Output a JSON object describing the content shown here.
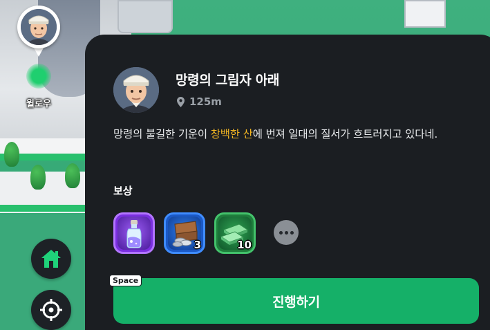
{
  "map": {
    "player_label": "윌로우"
  },
  "controls": {
    "home_icon": "home-icon",
    "locate_icon": "crosshair-icon"
  },
  "quest": {
    "title": "망령의 그림자 아래",
    "distance": "125m",
    "description_before": "망령의 불길한 기운이 ",
    "description_highlight": "창백한 산",
    "description_after": "에 번져 일대의 질서가 흐트러지고 있다네.",
    "highlight_color": "#f5b722"
  },
  "rewards": {
    "heading": "보상",
    "items": [
      {
        "icon": "potion-bottle-icon",
        "count": ""
      },
      {
        "icon": "treasure-chest-coins-icon",
        "count": "3"
      },
      {
        "icon": "cash-stack-icon",
        "count": "10"
      }
    ],
    "more_icon": "more-dots-icon"
  },
  "action": {
    "key_hint": "Space",
    "proceed_label": "진행하기",
    "color": "#15b068"
  }
}
